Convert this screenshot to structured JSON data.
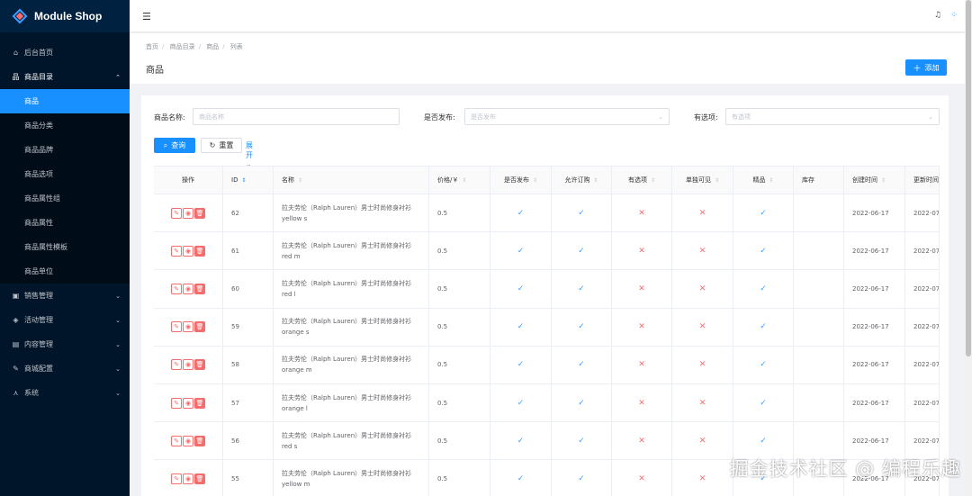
{
  "brand": {
    "name": "Module Shop"
  },
  "sidebar": {
    "items": [
      {
        "label": "后台首页",
        "icon": "home-icon",
        "glyph": "⌂",
        "has_children": false
      },
      {
        "label": "商品目录",
        "icon": "hierarchy-icon",
        "glyph": "品",
        "has_children": true,
        "open": true,
        "children": [
          "商品",
          "商品分类",
          "商品品牌",
          "商品选项",
          "商品属性组",
          "商品属性",
          "商品属性模板",
          "商品单位"
        ],
        "active_child": "商品"
      },
      {
        "label": "销售管理",
        "icon": "bag-icon",
        "glyph": "▣",
        "has_children": true
      },
      {
        "label": "活动管理",
        "icon": "tag-icon",
        "glyph": "◈",
        "has_children": true
      },
      {
        "label": "内容管理",
        "icon": "document-icon",
        "glyph": "▤",
        "has_children": true
      },
      {
        "label": "商城配置",
        "icon": "wrench-icon",
        "glyph": "✎",
        "has_children": true
      },
      {
        "label": "系统",
        "icon": "network-icon",
        "glyph": "⋏",
        "has_children": true
      }
    ]
  },
  "topbar": {
    "fold_icon": "menu-fold-icon",
    "bell_icon": "bell-icon",
    "dots_icon": "grid-dots-icon"
  },
  "breadcrumb": [
    "首页",
    "商品目录",
    "商品",
    "列表"
  ],
  "page": {
    "title": "商品",
    "add_label": "添加"
  },
  "filters": {
    "name_label": "商品名称:",
    "name_placeholder": "商品名称",
    "published_label": "是否发布:",
    "published_placeholder": "是否发布",
    "options_label": "有选项:",
    "options_placeholder": "有选项",
    "query_label": "查询",
    "reset_label": "重置",
    "expand_label": "展开"
  },
  "table": {
    "headers": [
      "操作",
      "ID",
      "名称",
      "价格/￥",
      "是否发布",
      "允许订购",
      "有选项",
      "单独可见",
      "精品",
      "库存",
      "创建时间",
      "更新时间"
    ],
    "rows": [
      {
        "id": "62",
        "name": "拉夫劳伦（Ralph Lauren）男士时尚修身衬衫 yellow s",
        "price": "0.5",
        "published": true,
        "orderable": true,
        "has_options": false,
        "individually_visible": false,
        "featured": true,
        "stock": "",
        "created": "2022-06-17",
        "updated": "2022-07-"
      },
      {
        "id": "61",
        "name": "拉夫劳伦（Ralph Lauren）男士时尚修身衬衫 red m",
        "price": "0.5",
        "published": true,
        "orderable": true,
        "has_options": false,
        "individually_visible": false,
        "featured": true,
        "stock": "",
        "created": "2022-06-17",
        "updated": "2022-07-"
      },
      {
        "id": "60",
        "name": "拉夫劳伦（Ralph Lauren）男士时尚修身衬衫 red l",
        "price": "0.5",
        "published": true,
        "orderable": true,
        "has_options": false,
        "individually_visible": false,
        "featured": true,
        "stock": "",
        "created": "2022-06-17",
        "updated": "2022-07-"
      },
      {
        "id": "59",
        "name": "拉夫劳伦（Ralph Lauren）男士时尚修身衬衫 orange s",
        "price": "0.5",
        "published": true,
        "orderable": true,
        "has_options": false,
        "individually_visible": false,
        "featured": true,
        "stock": "",
        "created": "2022-06-17",
        "updated": "2022-07-"
      },
      {
        "id": "58",
        "name": "拉夫劳伦（Ralph Lauren）男士时尚修身衬衫 orange m",
        "price": "0.5",
        "published": true,
        "orderable": true,
        "has_options": false,
        "individually_visible": false,
        "featured": true,
        "stock": "",
        "created": "2022-06-17",
        "updated": "2022-07-"
      },
      {
        "id": "57",
        "name": "拉夫劳伦（Ralph Lauren）男士时尚修身衬衫 orange l",
        "price": "0.5",
        "published": true,
        "orderable": true,
        "has_options": false,
        "individually_visible": false,
        "featured": true,
        "stock": "",
        "created": "2022-06-17",
        "updated": "2022-07-"
      },
      {
        "id": "56",
        "name": "拉夫劳伦（Ralph Lauren）男士时尚修身衬衫 red s",
        "price": "0.5",
        "published": true,
        "orderable": true,
        "has_options": false,
        "individually_visible": false,
        "featured": true,
        "stock": "",
        "created": "2022-06-17",
        "updated": "2022-07-"
      },
      {
        "id": "55",
        "name": "拉夫劳伦（Ralph Lauren）男士时尚修身衬衫 yellow m",
        "price": "0.5",
        "published": true,
        "orderable": true,
        "has_options": false,
        "individually_visible": false,
        "featured": true,
        "stock": "",
        "created": "2022-06-17",
        "updated": "2022-07-"
      }
    ]
  },
  "colors": {
    "sidebar_bg": "#001529",
    "primary": "#1890ff",
    "danger": "#f56c6c",
    "check": "#409eff"
  },
  "watermark": "掘金技术社区 @ 编程乐趣"
}
